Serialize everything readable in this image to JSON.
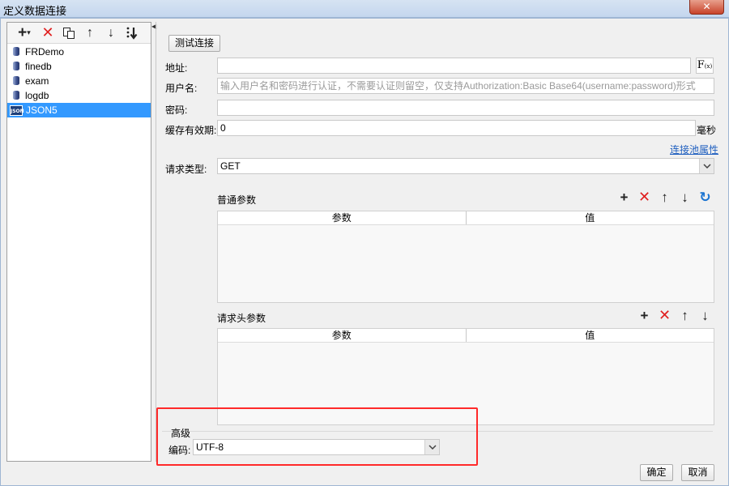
{
  "window": {
    "title": "定义数据连接",
    "close_label": "✕"
  },
  "left_toolbar": {
    "add": "+",
    "add_dropdown": "▾",
    "delete": "✕",
    "copy": "copy",
    "up": "↑",
    "down": "↓",
    "sort": "sort"
  },
  "data_sources": [
    {
      "name": "FRDemo",
      "icon": "database-icon",
      "selected": false
    },
    {
      "name": "finedb",
      "icon": "database-icon",
      "selected": false
    },
    {
      "name": "exam",
      "icon": "database-icon",
      "selected": false
    },
    {
      "name": "logdb",
      "icon": "database-icon",
      "selected": false
    },
    {
      "name": "JSON5",
      "icon": "json-icon",
      "icon_text": "JSON",
      "selected": true
    }
  ],
  "splitter": {
    "arrow": "◀"
  },
  "form": {
    "test_button": "测试连接",
    "address_label": "地址:",
    "address_value": "",
    "fx_label": "F",
    "fx_sub": "(x)",
    "username_label": "用户名:",
    "username_placeholder": "输入用户名和密码进行认证，不需要认证则留空，仅支持Authorization:Basic Base64(username:password)形式",
    "password_label": "密码:",
    "password_value": "",
    "cache_label": "缓存有效期:",
    "cache_value": "0",
    "cache_unit": "毫秒",
    "pool_link": "连接池属性",
    "request_type_label": "请求类型:",
    "request_type_value": "GET"
  },
  "params_section": {
    "title": "普通参数",
    "col_param": "参数",
    "col_value": "值",
    "tools": {
      "add": "+",
      "delete": "✕",
      "up": "↑",
      "down": "↓",
      "refresh": "↻"
    }
  },
  "headers_section": {
    "title": "请求头参数",
    "col_param": "参数",
    "col_value": "值",
    "tools": {
      "add": "+",
      "delete": "✕",
      "up": "↑",
      "down": "↓"
    }
  },
  "advanced": {
    "title": "高级",
    "encoding_label": "编码:",
    "encoding_value": "UTF-8"
  },
  "footer": {
    "ok": "确定",
    "cancel": "取消"
  },
  "colors": {
    "selection": "#3399ff",
    "highlight_border": "#ff2a2a",
    "link": "#1f5fbf",
    "delete": "#e02020"
  }
}
